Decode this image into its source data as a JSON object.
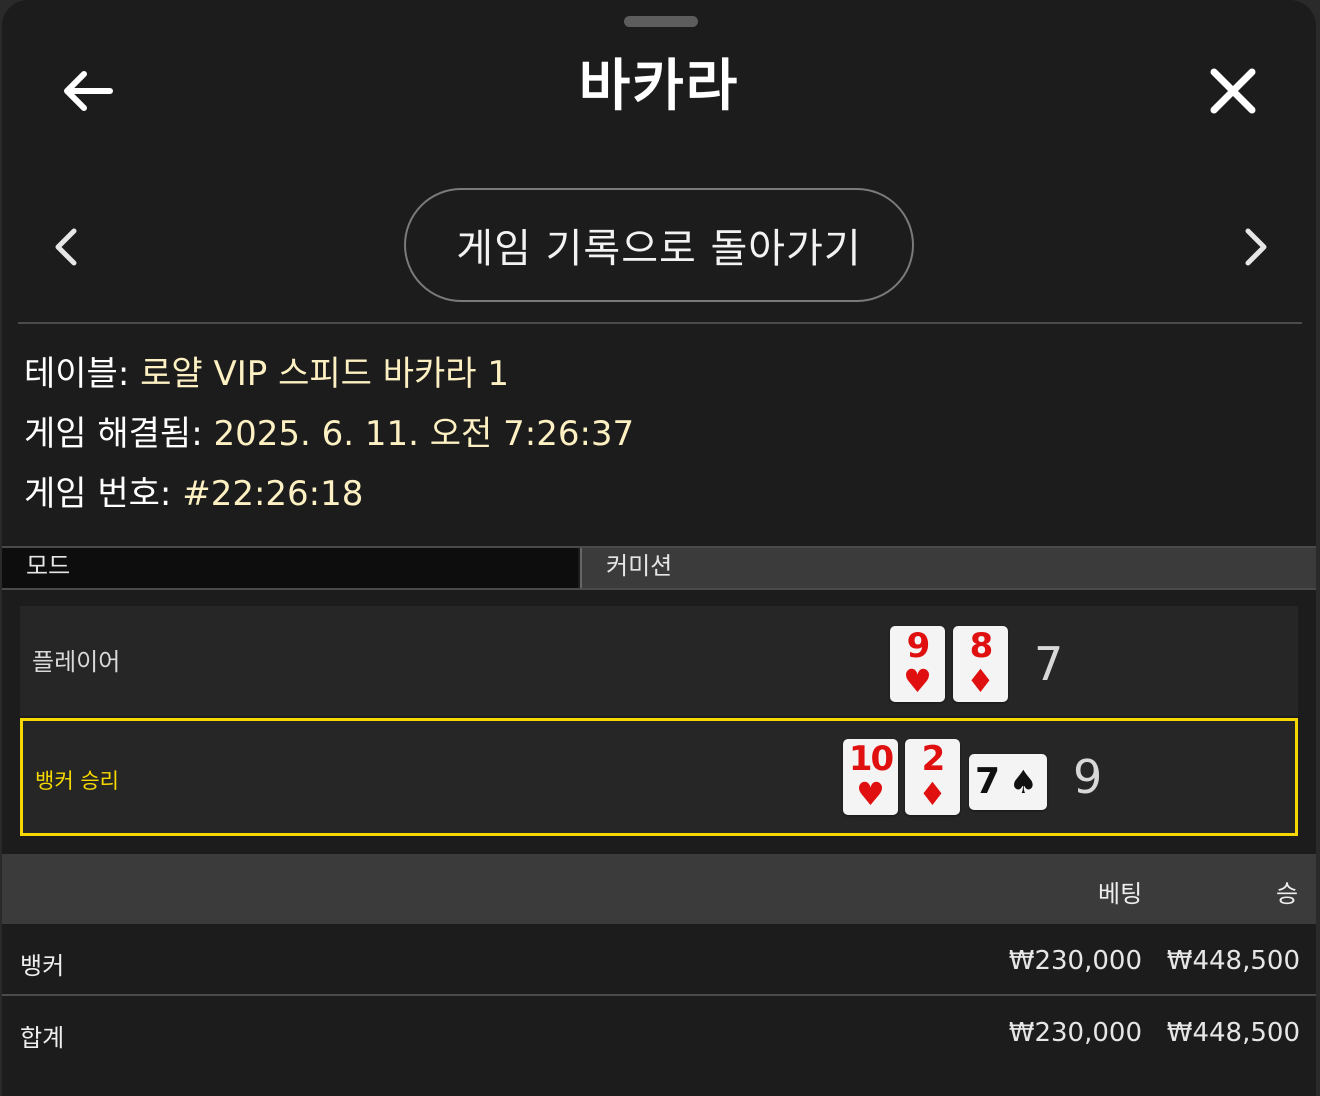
{
  "header": {
    "title": "바카라"
  },
  "nav": {
    "history_label": "게임 기록으로 돌아가기"
  },
  "info": {
    "table_label": "테이블:",
    "table_value": "로얄 VIP 스피드 바카라 1",
    "resolved_label": "게임 해결됨:",
    "resolved_value": "2025. 6. 11. 오전 7:26:37",
    "game_no_label": "게임 번호:",
    "game_no_value": "#22:26:18"
  },
  "mode": {
    "mode_label": "모드",
    "commission_label": "커미션"
  },
  "player": {
    "label": "플레이어",
    "cards": [
      {
        "rank": "9",
        "suit": "♥"
      },
      {
        "rank": "8",
        "suit": "♦"
      }
    ],
    "score": "7"
  },
  "banker": {
    "label": "뱅커 승리",
    "cards": [
      {
        "rank": "10",
        "suit": "♥"
      },
      {
        "rank": "2",
        "suit": "♦"
      }
    ],
    "side_card": {
      "rank": "7",
      "suit": "♠"
    },
    "score": "9"
  },
  "bets": {
    "col_bet": "베팅",
    "col_win": "승",
    "rows": [
      {
        "name": "뱅커",
        "bet": "₩230,000",
        "win": "₩448,500"
      },
      {
        "name": "합계",
        "bet": "₩230,000",
        "win": "₩448,500"
      }
    ]
  },
  "colors": {
    "accent": "#f5d800",
    "info_value": "#fdf0c2",
    "card_red": "#e01010"
  }
}
